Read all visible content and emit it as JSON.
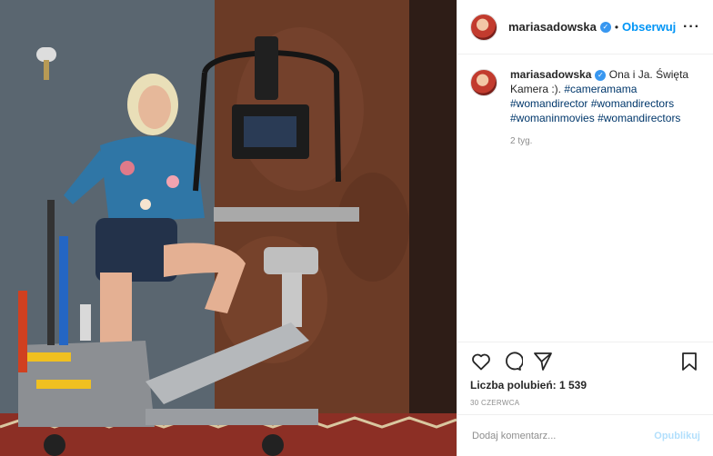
{
  "post": {
    "username": "mariasadowska",
    "follow_label": "Obserwuj",
    "dot": "•",
    "more_label": "···",
    "verified_glyph": "✓",
    "caption_plain": "Ona i Ja. Święta Kamera :).",
    "hashtags": [
      "#cameramama",
      "#womandirector",
      "#womandirectors",
      "#womaninmovies",
      "#womandirectors"
    ],
    "comment_time": "2 tyg.",
    "likes_text": "Liczba polubień: 1 539",
    "date": "30 CZERWCA",
    "comment_placeholder": "Dodaj komentarz...",
    "publish_label": "Opublikuj"
  },
  "icons": {
    "like": "heart-icon",
    "comment": "comment-bubble-icon",
    "share": "paper-plane-icon",
    "save": "bookmark-icon",
    "more": "more-options-icon"
  },
  "colors": {
    "accent": "#0095f6",
    "verified": "#3897f0",
    "publish_disabled": "#b2dffc",
    "muted": "#8e8e8e"
  }
}
